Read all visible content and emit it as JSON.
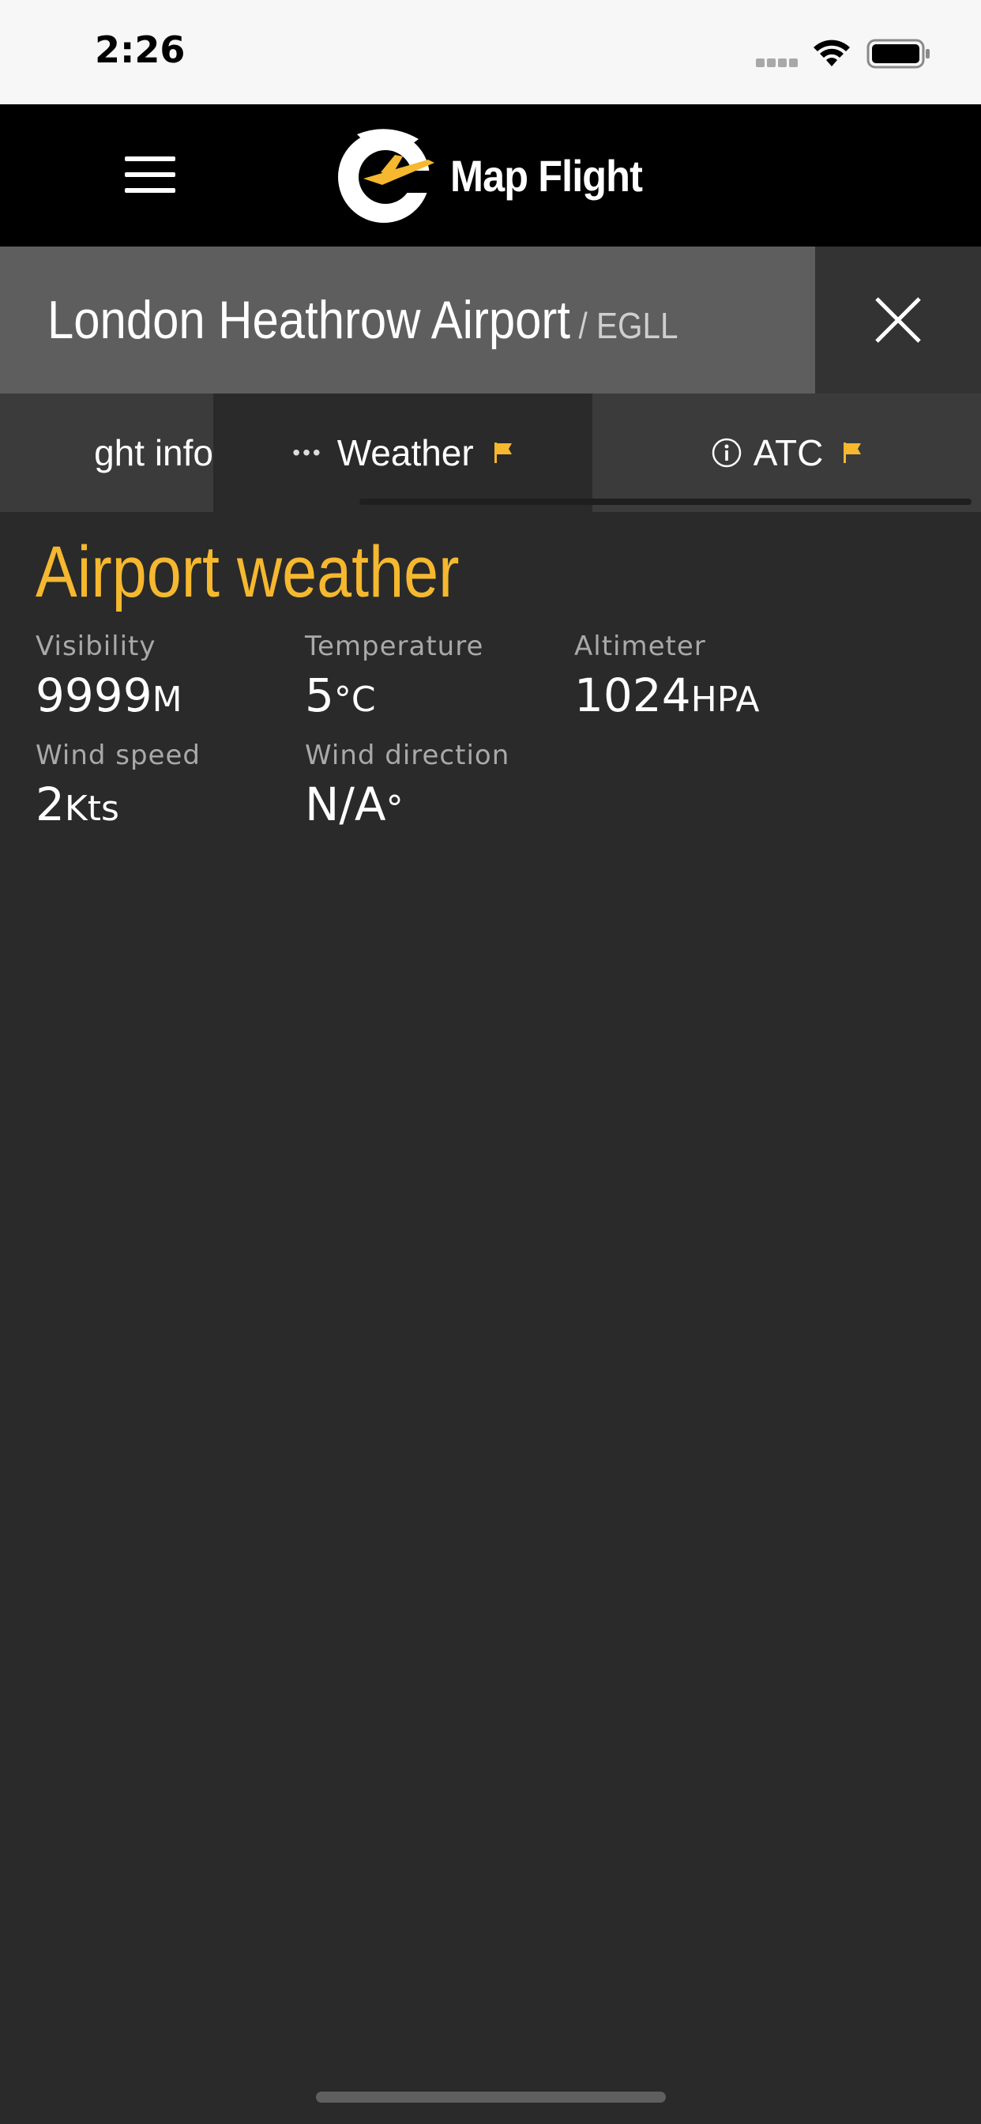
{
  "status_bar": {
    "time": "2:26"
  },
  "header": {
    "logo_text": "Map Flight"
  },
  "title_bar": {
    "airport_name": "London Heathrow Airport",
    "airport_code": "/ EGLL"
  },
  "tabs": [
    {
      "label": "Flight info",
      "visible_text": "ght info"
    },
    {
      "label": "Weather",
      "icon": "dots-icon",
      "flag": "flag-icon"
    },
    {
      "label": "ATC",
      "icon": "info-circle-icon",
      "flag": "flag-icon"
    }
  ],
  "weather": {
    "title": "Airport weather",
    "visibility": {
      "label": "Visibility",
      "value": "9999",
      "unit": "M"
    },
    "temperature": {
      "label": "Temperature",
      "value": "5",
      "unit": "°C"
    },
    "altimeter": {
      "label": "Altimeter",
      "value": "1024",
      "unit": "HPA"
    },
    "wind_speed": {
      "label": "Wind speed",
      "value": "2",
      "unit": "Kts"
    },
    "wind_direction": {
      "label": "Wind direction",
      "value": "N/A",
      "unit": "°"
    }
  },
  "colors": {
    "accent": "#f5b82e",
    "background": "#2a2a2a",
    "header": "#000000",
    "title_bar": "#5e5e5e"
  }
}
